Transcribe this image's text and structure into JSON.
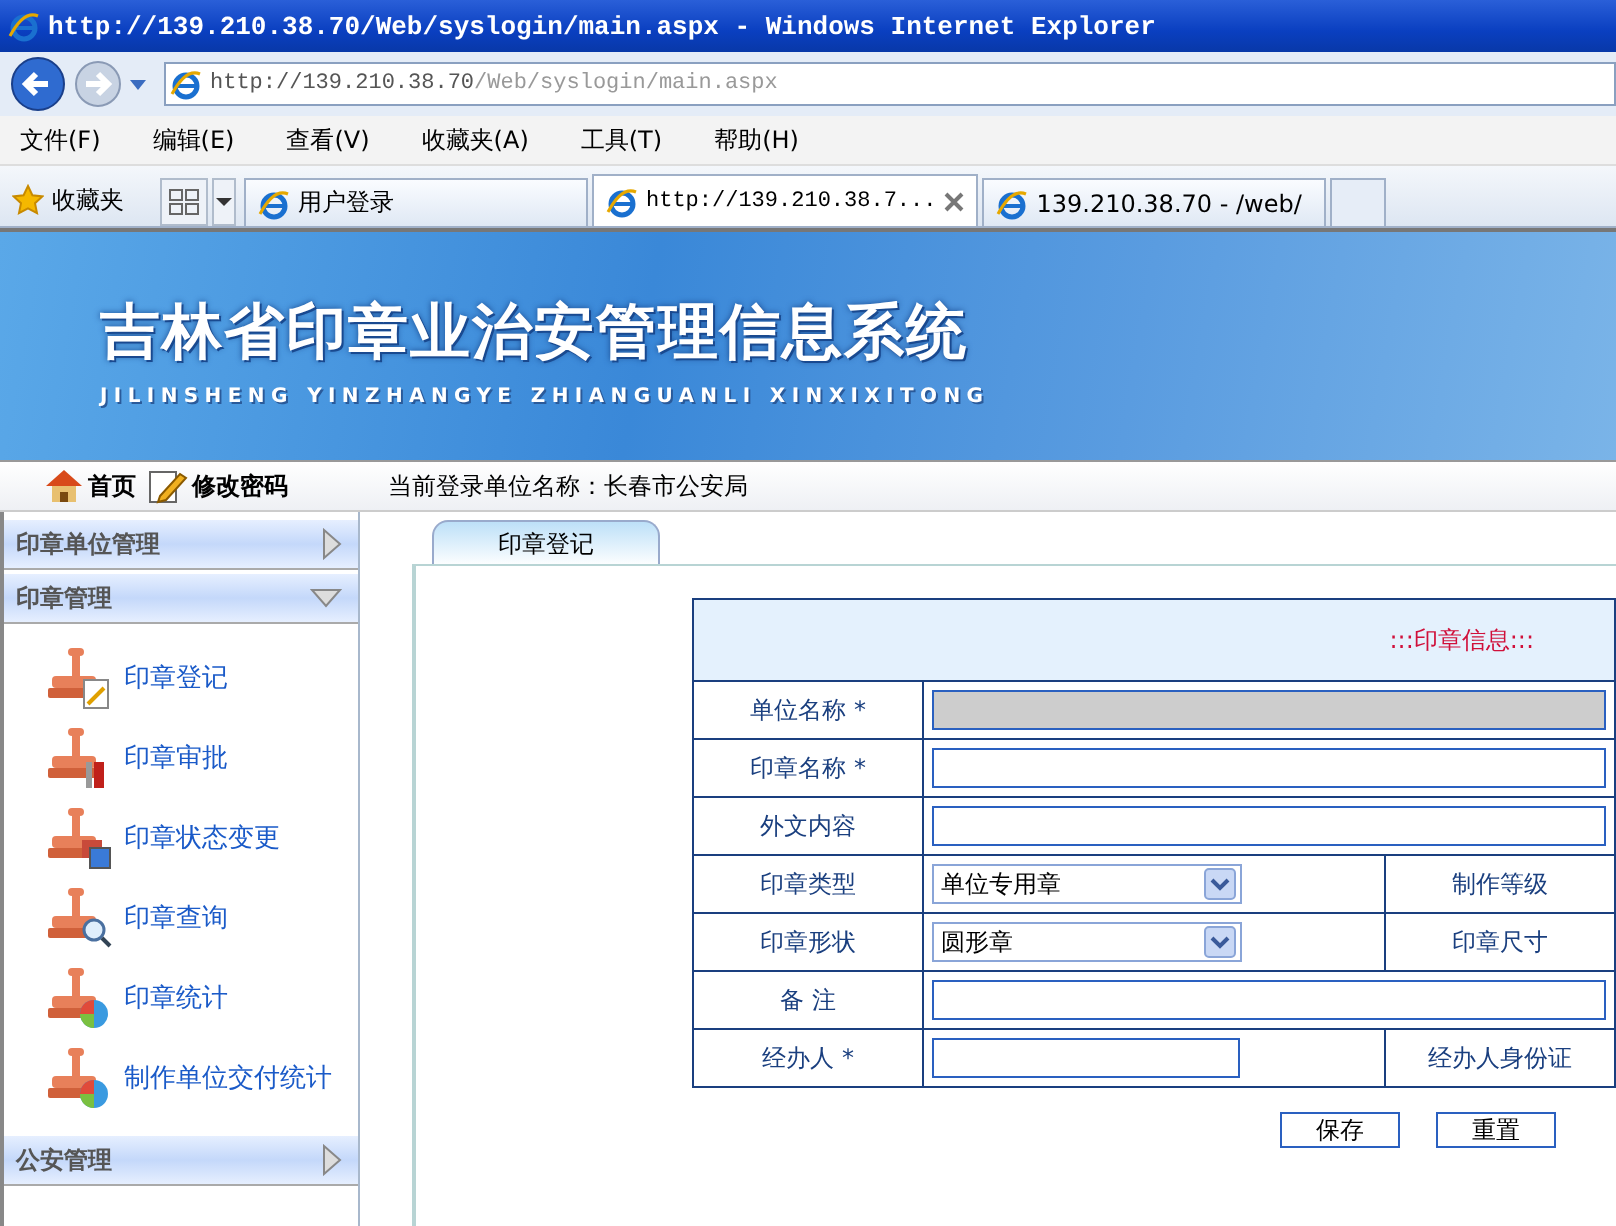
{
  "browser": {
    "title": "http://139.210.38.70/Web/syslogin/main.aspx - Windows Internet Explorer",
    "address_host": "http://139.210.38.70",
    "address_path": "/Web/syslogin/main.aspx",
    "menu": [
      "文件(F)",
      "编辑(E)",
      "查看(V)",
      "收藏夹(A)",
      "工具(T)",
      "帮助(H)"
    ],
    "favorites": "收藏夹",
    "tabs": [
      {
        "label": "用户登录",
        "selected": false
      },
      {
        "label": "http://139.210.38.7...",
        "selected": true
      },
      {
        "label": "139.210.38.70 - /web/",
        "selected": false
      }
    ]
  },
  "banner": {
    "title": "吉林省印章业治安管理信息系统",
    "subtitle": "JILINSHENG YINZHANGYE ZHIANGUANLI XINXIXITONG"
  },
  "nav": {
    "links": [
      "首页",
      "修改密码"
    ],
    "login_unit": "当前登录单位名称：长春市公安局"
  },
  "sidebar": [
    {
      "label": "印章单位管理",
      "expanded": false
    },
    {
      "label": "印章管理",
      "expanded": true,
      "children": [
        {
          "label": "印章登记"
        },
        {
          "label": "印章审批"
        },
        {
          "label": "印章状态变更"
        },
        {
          "label": "印章查询"
        },
        {
          "label": "印章统计"
        },
        {
          "label": "制作单位交付统计"
        }
      ]
    },
    {
      "label": "公安管理",
      "expanded": false
    }
  ],
  "content": {
    "tabs": [
      {
        "label": "印章登记",
        "selected": true
      }
    ],
    "form": {
      "heading": ":::印章信息:::",
      "rows": [
        {
          "kind": "text",
          "label": "单位名称 *",
          "disabled": true
        },
        {
          "kind": "text",
          "label": "印章名称 *",
          "disabled": false
        },
        {
          "kind": "text",
          "label": "外文内容",
          "disabled": false
        },
        {
          "kind": "select",
          "label": "印章类型",
          "value": "单位专用章",
          "extra_label": "制作等级"
        },
        {
          "kind": "select",
          "label": "印章形状",
          "value": "圆形章",
          "extra_label": "印章尺寸"
        },
        {
          "kind": "text",
          "label": "备 注",
          "disabled": false
        },
        {
          "kind": "short",
          "label": "经办人 *",
          "extra_label": "经办人身份证"
        }
      ]
    },
    "buttons": [
      "保存",
      "重置"
    ]
  }
}
